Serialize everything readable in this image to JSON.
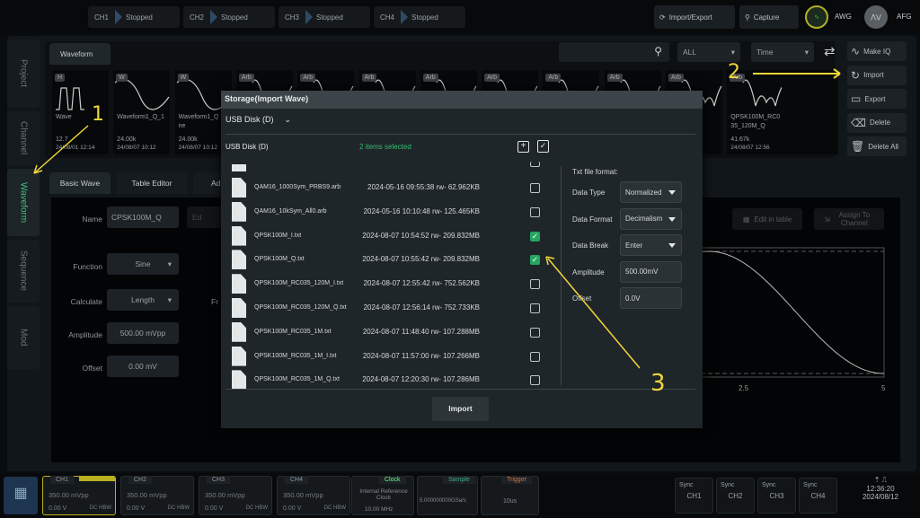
{
  "topbar": {
    "channels": [
      {
        "label": "CH1",
        "status": "Stopped"
      },
      {
        "label": "CH2",
        "status": "Stopped"
      },
      {
        "label": "CH3",
        "status": "Stopped"
      },
      {
        "label": "CH4",
        "status": "Stopped"
      }
    ],
    "import_export": "Import/Export",
    "capture": "Capture",
    "awg": "AWG",
    "afg": "AFG"
  },
  "side_tabs": [
    "Project",
    "Channel",
    "Waveform",
    "Sequence",
    "Mod"
  ],
  "library": {
    "tab": "Waveform",
    "filter": "ALL",
    "sort": "Time",
    "thumbs": [
      {
        "tag": "H",
        "name": "Wave",
        "size": "12.7",
        "date": "24/08/01 12:14"
      },
      {
        "tag": "W",
        "name": "Waveform1_Q_1",
        "size": "24.00k",
        "date": "24/08/07 10:12"
      },
      {
        "tag": "W",
        "name": "Waveform1_Q 1sine",
        "size": "24.00k",
        "date": "24/08/07 10:12"
      },
      {
        "tag": "Arb"
      },
      {
        "tag": "Arb"
      },
      {
        "tag": "Arb"
      },
      {
        "tag": "Arb"
      },
      {
        "tag": "Arb"
      },
      {
        "tag": "Arb"
      },
      {
        "tag": "Arb"
      },
      {
        "tag": "Arb",
        "name": "_R _I",
        "date": "56"
      },
      {
        "tag": "Arb",
        "name": "QPSK100M_RC035_120M_Q",
        "size": "41.67k",
        "date": "24/08/07 12:56"
      }
    ],
    "actions": [
      "Make IQ",
      "Import",
      "Export",
      "Delete",
      "Delete All"
    ]
  },
  "editor": {
    "tabs": [
      "Basic Wave",
      "Table Editor",
      "Ad"
    ],
    "name_label": "Name",
    "name_value": "CPSK100M_Q",
    "function_label": "Function",
    "function_value": "Sine",
    "calculate_label": "Calculate",
    "calculate_value": "Length",
    "freq_partial": "Fr",
    "amplitude_label": "Amplitude",
    "amplitude_value": "500.00 mVpp",
    "offset_label": "Offset",
    "offset_value": "0.00 mV",
    "edit_partial": "Ed",
    "edit_in_table": "Edit in table",
    "assign_to_channel": "Assign To Channel",
    "x_ticks": [
      "2.5",
      "5"
    ]
  },
  "dialog": {
    "title": "Storage(Import Wave)",
    "drive": "USB Disk (D)",
    "path": "USB Disk (D)",
    "selection": "2 items selected",
    "files": [
      {
        "name": "QAM16_1000Sym_PRBS9.arb",
        "meta": "2024-05-16 09:55:38 rw- 62.962KB",
        "checked": false
      },
      {
        "name": "QAM16_10kSym_All0.arb",
        "meta": "2024-05-16 10:10:48 rw- 125.465KB",
        "checked": false
      },
      {
        "name": "QPSK100M_I.txt",
        "meta": "2024-08-07 10:54:52 rw- 209.832MB",
        "checked": true
      },
      {
        "name": "QPSK100M_Q.txt",
        "meta": "2024-08-07 10:55:42 rw- 209.832MB",
        "checked": true
      },
      {
        "name": "QPSK100M_RC035_120M_I.txt",
        "meta": "2024-08-07 12:55:42 rw- 752.562KB",
        "checked": false
      },
      {
        "name": "QPSK100M_RC035_120M_Q.txt",
        "meta": "2024-08-07 12:56:14 rw- 752.733KB",
        "checked": false
      },
      {
        "name": "QPSK100M_RC035_1M.txt",
        "meta": "2024-08-07 11:48:40 rw- 107.288MB",
        "checked": false
      },
      {
        "name": "QPSK100M_RC035_1M_I.txt",
        "meta": "2024-08-07 11:57:00 rw- 107.266MB",
        "checked": false
      },
      {
        "name": "QPSK100M_RC035_1M_Q.txt",
        "meta": "2024-08-07 12:20:30 rw- 107.286MB",
        "checked": false
      }
    ],
    "format_title": "Txt file format:",
    "params": [
      {
        "label": "Data Type",
        "value": "Normalized",
        "dropdown": true
      },
      {
        "label": "Data Format",
        "value": "Decimalism",
        "dropdown": true
      },
      {
        "label": "Data Break",
        "value": "Enter",
        "dropdown": true
      },
      {
        "label": "Amplitude",
        "value": "500.00mV",
        "dropdown": false
      },
      {
        "label": "Offset",
        "value": "0.0V",
        "dropdown": false
      }
    ],
    "import_button": "Import"
  },
  "bottom": {
    "channels": [
      {
        "label": "CH1",
        "amp": "350.00 mVpp",
        "offset": "0.00 V",
        "coupling": "DC HBW"
      },
      {
        "label": "CH2",
        "amp": "350.00 mVpp",
        "offset": "0.00 V",
        "coupling": "DC HBW"
      },
      {
        "label": "CH3",
        "amp": "350.00 mVpp",
        "offset": "0.00 V",
        "coupling": "DC HBW"
      },
      {
        "label": "CH4",
        "amp": "350.00 mVpp",
        "offset": "0.00 V",
        "coupling": "DC HBW"
      }
    ],
    "clock": {
      "title": "Clock",
      "source": "Internal Reference Clock",
      "freq": "10.00 MHz"
    },
    "sample": {
      "title": "Sample",
      "value": "5.000000000GSa/s"
    },
    "trigger": {
      "title": "Trigger",
      "value": "10us"
    },
    "sync": [
      {
        "label": "Sync",
        "ch": "CH1"
      },
      {
        "label": "Sync",
        "ch": "CH2"
      },
      {
        "label": "Sync",
        "ch": "CH3"
      },
      {
        "label": "Sync",
        "ch": "CH4"
      }
    ],
    "time": "12:36:20",
    "date": "2024/08/12"
  },
  "annotations": [
    "1",
    "2",
    "3"
  ],
  "colors": {
    "accent_green": "#25a55f",
    "annotation_yellow": "#f0d63a",
    "ch1_yellow": "#b8b020"
  }
}
